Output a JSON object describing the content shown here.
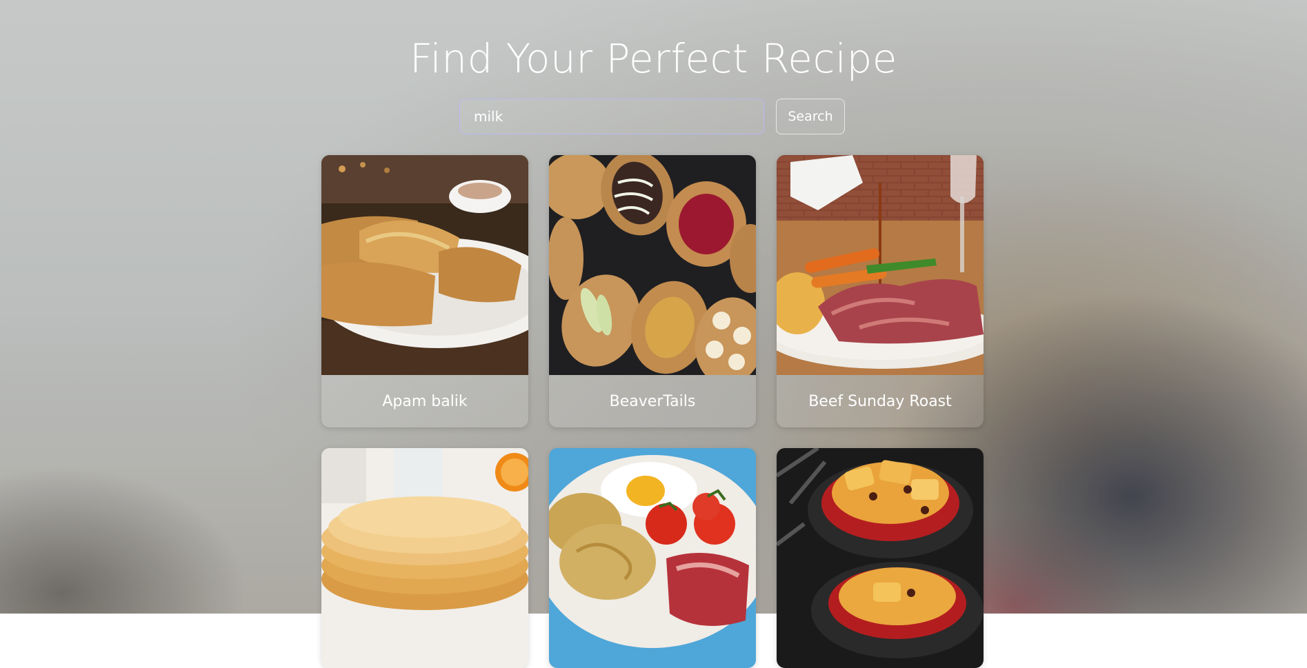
{
  "header": {
    "title": "Find Your Perfect Recipe"
  },
  "search": {
    "value": "milk",
    "button_label": "Search"
  },
  "recipes": [
    {
      "name": "Apam balik",
      "image_icon": "apam-balik-photo"
    },
    {
      "name": "BeaverTails",
      "image_icon": "beavertails-photo"
    },
    {
      "name": "Beef Sunday Roast",
      "image_icon": "beef-roast-photo"
    },
    {
      "name": "",
      "image_icon": "pancakes-photo"
    },
    {
      "name": "",
      "image_icon": "breakfast-photo"
    },
    {
      "name": "",
      "image_icon": "bread-pudding-photo"
    }
  ]
}
